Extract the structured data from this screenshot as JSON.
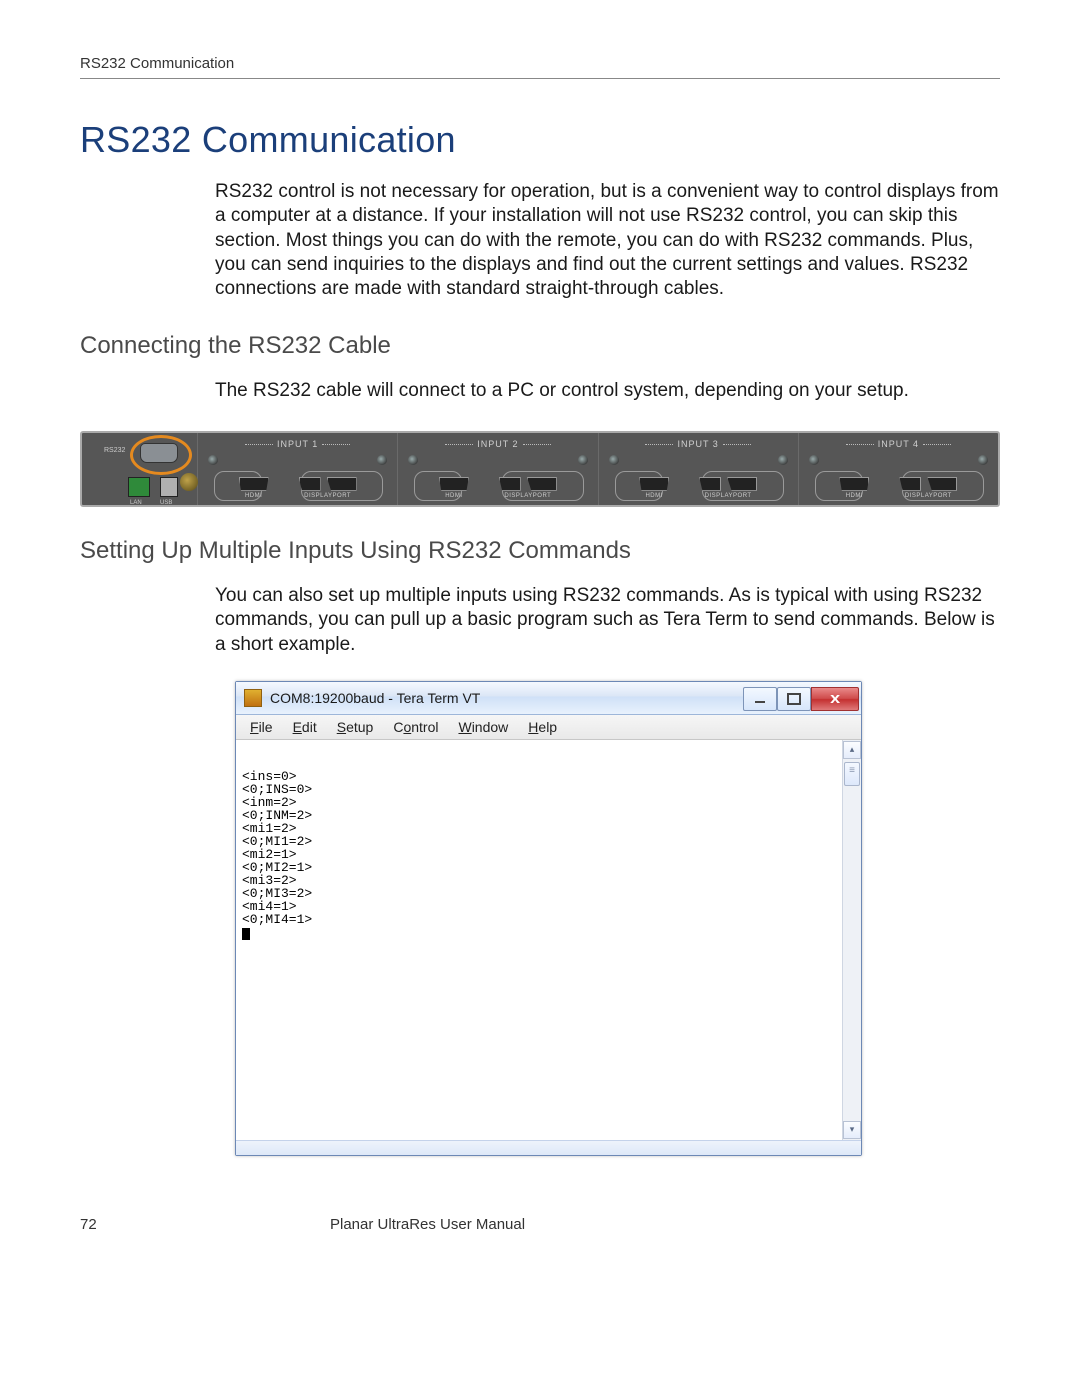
{
  "page": {
    "running_head": "RS232 Communication",
    "number": "72",
    "footer": "Planar UltraRes User Manual"
  },
  "section": {
    "title": "RS232 Communication",
    "intro": "RS232 control is not necessary for operation, but is a convenient way to control displays from a computer at a distance. If your installation will not use RS232 control, you can skip this section. Most things you can do with the remote, you can do with RS232 commands. Plus, you can send inquiries to the displays and find out the current settings and values. RS232 connections are made with standard straight-through cables."
  },
  "sub_connect": {
    "title": "Connecting the RS232 Cable",
    "text": "The RS232 cable will connect to a PC or control system, depending on your setup."
  },
  "device": {
    "rs232_label": "RS232",
    "lan_label": "LAN",
    "usb_label": "USB",
    "inputs": [
      {
        "label": "INPUT 1",
        "hdmi": "HDMI",
        "dp": "DISPLAYPORT"
      },
      {
        "label": "INPUT 2",
        "hdmi": "HDMI",
        "dp": "DISPLAYPORT"
      },
      {
        "label": "INPUT 3",
        "hdmi": "HDMI",
        "dp": "DISPLAYPORT"
      },
      {
        "label": "INPUT 4",
        "hdmi": "HDMI",
        "dp": "DISPLAYPORT"
      }
    ]
  },
  "sub_multi": {
    "title": "Setting Up Multiple Inputs Using RS232 Commands",
    "text": "You can also set up multiple inputs using RS232 commands. As is typical with using RS232 commands, you can pull up a basic program such as Tera Term to send commands. Below is a short example."
  },
  "teraterm": {
    "title": "COM8:19200baud - Tera Term VT",
    "menu": {
      "file": {
        "u": "F",
        "rest": "ile"
      },
      "edit": {
        "u": "E",
        "rest": "dit"
      },
      "setup": {
        "u": "S",
        "rest": "etup"
      },
      "control": {
        "pre": "C",
        "u": "o",
        "rest": "ntrol"
      },
      "window": {
        "u": "W",
        "rest": "indow"
      },
      "help": {
        "u": "H",
        "rest": "elp"
      }
    },
    "lines": [
      "<ins=0>",
      "<0;INS=0>",
      "<inm=2>",
      "<0;INM=2>",
      "<mi1=2>",
      "<0;MI1=2>",
      "<mi2=1>",
      "<0;MI2=1>",
      "<mi3=2>",
      "<0;MI3=2>",
      "<mi4=1>",
      "<0;MI4=1>"
    ],
    "scroll": {
      "up": "▴",
      "down": "▾"
    }
  }
}
